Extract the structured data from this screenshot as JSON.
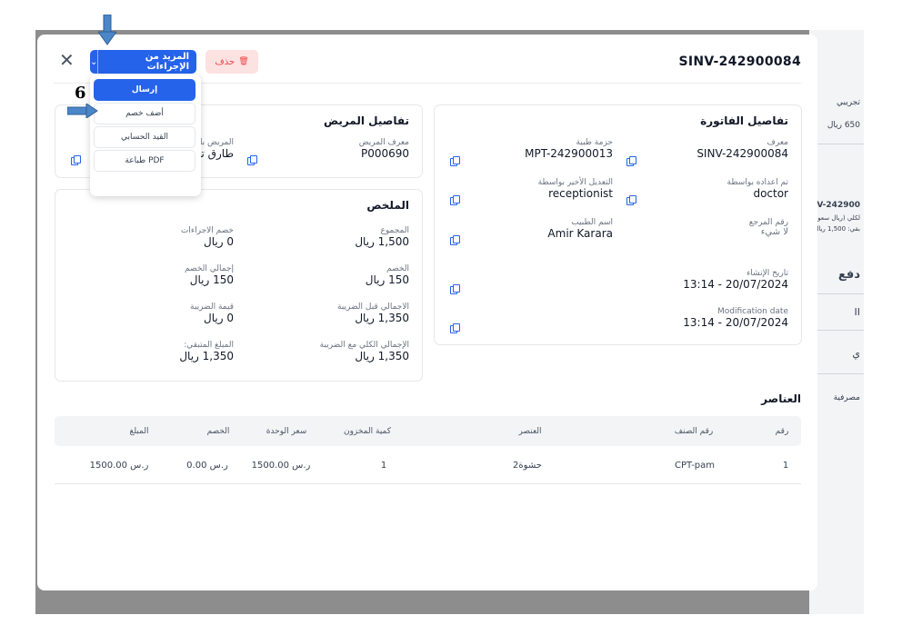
{
  "background": {
    "texts": [
      "تجريبي",
      "650 ريال",
      "NV-242900",
      "لكلي (ريال سعودي",
      "بقي: 1,500 ريال",
      "دفع",
      "II",
      "ي",
      "مصرفية"
    ]
  },
  "modal": {
    "invoice_id": "SINV-242900084",
    "close_label": "✕",
    "more_actions_label": "المزيد من الإجراءات",
    "more_actions_chevron": "⌄",
    "delete_label": "حذف",
    "delete_icon": "🗑"
  },
  "dropdown": {
    "items": [
      {
        "label": "إرسال",
        "active": true
      },
      {
        "label": "أضف خصم",
        "active": false
      },
      {
        "label": "القيد الحسابي",
        "active": false
      },
      {
        "label": "طباعة PDF",
        "active": false
      }
    ]
  },
  "invoice_details": {
    "title": "تفاصيل الفاتورة",
    "fields": [
      {
        "label": "معرف",
        "value": "SINV-242900084"
      },
      {
        "label": "حزمة طبية",
        "value": "MPT-242900013"
      },
      {
        "label": "تم اعداده بواسطة",
        "value": "doctor"
      },
      {
        "label": "التعديل الأخير بواسطة",
        "value": "receptionist"
      },
      {
        "label": "رقم المرجع",
        "value": "لا شيء"
      },
      {
        "label": "اسم الطبيب",
        "value": "Amir Karara"
      },
      {
        "label": "تاريخ الإنشاء",
        "value": "20/07/2024 - 13:14"
      },
      {
        "label": "Modification date",
        "value": "20/07/2024 - 13:14"
      }
    ]
  },
  "patient_details": {
    "title": "تفاصيل المريض",
    "fields": [
      {
        "label": "معرف المريض",
        "value": "P000690"
      },
      {
        "label": "المريض بالـ",
        "value": "طارق تجـ"
      }
    ]
  },
  "summary": {
    "title": "الملخص",
    "fields": [
      {
        "label": "المجموع",
        "value": "1,500 ريال"
      },
      {
        "label": "خصم الاجراءات",
        "value": "0 ريال"
      },
      {
        "label": "الخصم",
        "value": "150 ريال"
      },
      {
        "label": "إجمالي الخصم",
        "value": "150 ريال"
      },
      {
        "label": "الاجمالي قبل الضريبة",
        "value": "1,350 ريال"
      },
      {
        "label": "قيمة الضريبة",
        "value": "0 ريال"
      },
      {
        "label": "الإجمالي الكلي مع الضريبة",
        "value": "1,350 ريال"
      },
      {
        "label": "المبلغ المتبقي:",
        "value": "1,350 ريال"
      }
    ]
  },
  "items": {
    "title": "العناصر",
    "columns": [
      "رقم",
      "رقم الصنف",
      "العنصر",
      "كمية المخزون",
      "سعر الوحدة",
      "الخصم",
      "المبلغ"
    ],
    "rows": [
      [
        "1",
        "CPT-pam",
        "حشوة2",
        "1",
        "1500.00 ر.س",
        "0.00 ر.س",
        "1500.00 ر.س"
      ]
    ]
  },
  "annotation": {
    "step_number": "6"
  },
  "colors": {
    "primary": "#2563eb",
    "danger_bg": "#fde2e2",
    "danger_text": "#ef4444",
    "annotation_arrow": "#4a86c8"
  }
}
